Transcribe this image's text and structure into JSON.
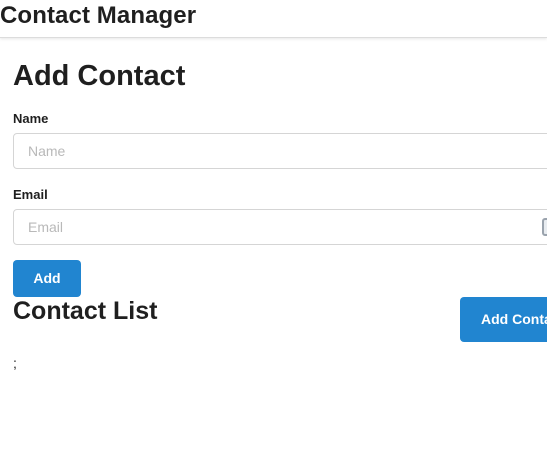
{
  "header": {
    "title": "Contact Manager"
  },
  "form": {
    "title": "Add Contact",
    "name_label": "Name",
    "name_placeholder": "Name",
    "name_value": "",
    "email_label": "Email",
    "email_placeholder": "Email",
    "email_value": "",
    "submit_label": "Add"
  },
  "contact_list": {
    "title": "Contact List",
    "add_contact_label": "Add Contact",
    "content": ";"
  },
  "colors": {
    "primary_button": "#2185d0",
    "button_text": "#ffffff",
    "input_border": "#d5d5d5",
    "placeholder": "#b9b9b9"
  },
  "icons": {
    "email_autofill": "autofill-key-icon"
  }
}
